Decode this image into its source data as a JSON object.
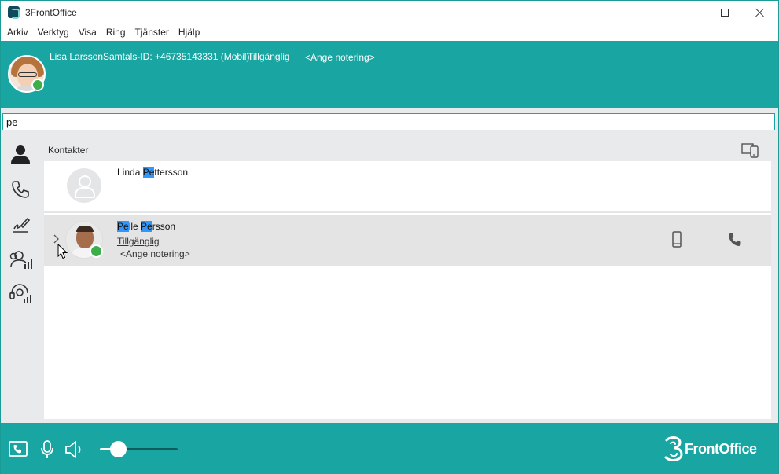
{
  "window": {
    "title": "3FrontOffice"
  },
  "menu": {
    "items": [
      "Arkiv",
      "Verktyg",
      "Visa",
      "Ring",
      "Tjänster",
      "Hjälp"
    ]
  },
  "profile": {
    "name": "Lisa Larsson",
    "call_id": "Samtals-ID: +46735143331 (Mobil)",
    "status": "Tillgänglig",
    "note": "<Ange notering>",
    "status_color": "#3dae49"
  },
  "search": {
    "value": "pe"
  },
  "nav": {
    "items": [
      "contacts-icon",
      "phone-icon",
      "signature-icon",
      "team-icon",
      "queue-stats-icon"
    ]
  },
  "contacts": {
    "section_title": "Kontakter",
    "rows": [
      {
        "name_parts": [
          "Linda ",
          "Pe",
          "ttersson"
        ],
        "status": "",
        "note": ""
      },
      {
        "name_parts": [
          "Pe",
          "lle ",
          "Pe",
          "rsson"
        ],
        "status": "Tillgänglig",
        "note": "<Ange notering>"
      }
    ]
  },
  "bottom": {
    "volume_level": 0.24,
    "brand": "FrontOffice"
  },
  "colors": {
    "accent": "#19a6a2",
    "highlight": "#3297fd",
    "panel": "#e8eaec"
  }
}
